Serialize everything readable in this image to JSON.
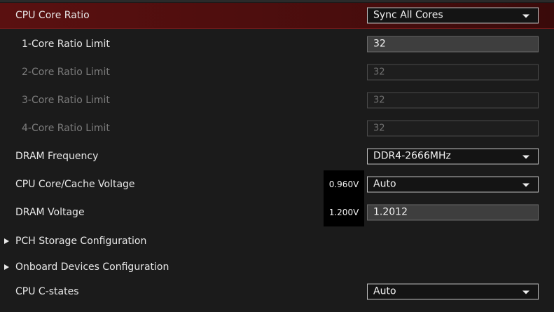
{
  "settings": [
    {
      "label": "CPU Core Ratio",
      "value": "Sync All Cores"
    },
    {
      "label": "1-Core Ratio Limit",
      "value": "32"
    },
    {
      "label": "2-Core Ratio Limit",
      "value": "32"
    },
    {
      "label": "3-Core Ratio Limit",
      "value": "32"
    },
    {
      "label": "4-Core Ratio Limit",
      "value": "32"
    },
    {
      "label": "DRAM Frequency",
      "value": "DDR4-2666MHz"
    },
    {
      "label": "CPU Core/Cache Voltage",
      "readout": "0.960V",
      "value": "Auto"
    },
    {
      "label": "DRAM Voltage",
      "readout": "1.200V",
      "value": "1.2012"
    },
    {
      "label": "PCH Storage Configuration"
    },
    {
      "label": "Onboard Devices Configuration"
    },
    {
      "label": "CPU C-states",
      "value": "Auto"
    }
  ],
  "theme": {
    "selection_color": "#5a1010",
    "background": "#1b1b1b"
  },
  "icons": {
    "dropdown": "chevron-down-icon",
    "submenu": "submenu-arrow-icon"
  }
}
